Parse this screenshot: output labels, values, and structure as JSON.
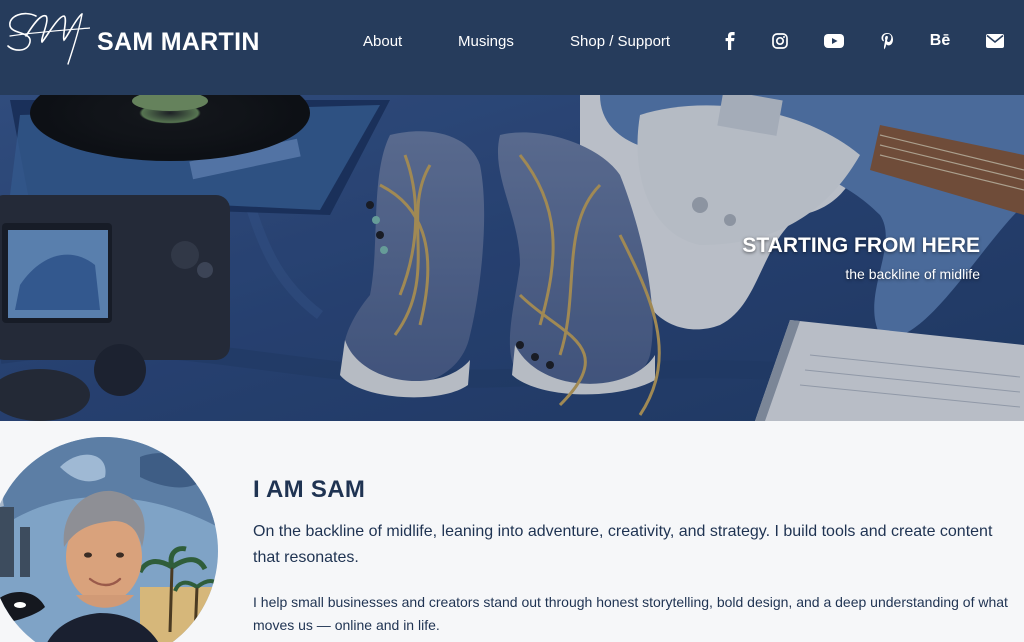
{
  "header": {
    "logo_monogram": "SM",
    "brand_name": "SAM MARTIN",
    "nav": [
      {
        "label": "About"
      },
      {
        "label": "Musings"
      },
      {
        "label": "Shop / Support"
      }
    ],
    "social": [
      {
        "icon": "facebook-icon"
      },
      {
        "icon": "instagram-icon"
      },
      {
        "icon": "youtube-icon"
      },
      {
        "icon": "pinterest-icon"
      },
      {
        "icon": "behance-icon",
        "glyph": "Bē"
      },
      {
        "icon": "email-icon"
      }
    ]
  },
  "hero": {
    "title": "STARTING FROM HERE",
    "subtitle": "the backline of midlife"
  },
  "about": {
    "heading": "I AM SAM",
    "lead": "On the backline of midlife, leaning into adventure, creativity, and strategy. I build tools and create content that resonates.",
    "body": "I help small businesses and creators stand out through honest storytelling, bold design, and a deep understanding of what moves us — online and in life."
  },
  "colors": {
    "header_bg": "#263c5c",
    "text": "#1f3352",
    "page_bg": "#f6f7f9"
  }
}
